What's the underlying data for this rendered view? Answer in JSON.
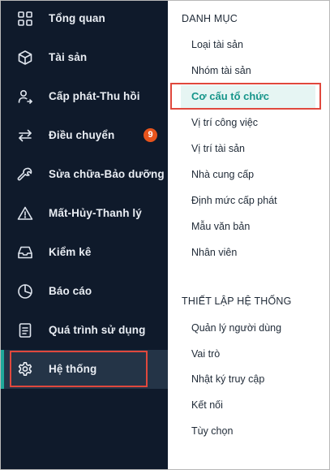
{
  "sidebar": {
    "items": [
      {
        "label": "Tổng quan",
        "icon": "dashboard-grid-icon"
      },
      {
        "label": "Tài sản",
        "icon": "box-icon"
      },
      {
        "label": "Cấp phát-Thu hồi",
        "icon": "user-transfer-icon"
      },
      {
        "label": "Điều chuyển",
        "icon": "swap-arrows-icon",
        "badge": "9"
      },
      {
        "label": "Sửa chữa-Bảo dưỡng",
        "icon": "wrench-icon"
      },
      {
        "label": "Mất-Hủy-Thanh lý",
        "icon": "warning-triangle-icon"
      },
      {
        "label": "Kiểm kê",
        "icon": "inbox-tray-icon"
      },
      {
        "label": "Báo cáo",
        "icon": "pie-chart-icon"
      },
      {
        "label": "Quá trình sử dụng",
        "icon": "document-list-icon"
      },
      {
        "label": "Hệ thống",
        "icon": "gear-icon",
        "active": true
      }
    ]
  },
  "submenu": {
    "sections": [
      {
        "title": "DANH MỤC",
        "items": [
          "Loại tài sản",
          "Nhóm tài sản",
          "Cơ cấu tổ chức",
          "Vị trí công việc",
          "Vị trí tài sản",
          "Nhà cung cấp",
          "Định mức cấp phát",
          "Mẫu văn bản",
          "Nhân viên"
        ],
        "active_item": "Cơ cấu tổ chức"
      },
      {
        "title": "THIẾT LẬP HỆ THỐNG",
        "items": [
          "Quản lý người dùng",
          "Vai trò",
          "Nhật ký truy cập",
          "Kết nối",
          "Tùy chọn"
        ]
      }
    ]
  },
  "colors": {
    "sidebar_bg": "#0f1a2b",
    "active_bg": "#243447",
    "accent": "#1fa89a",
    "badge": "#e8541c",
    "highlight_border": "#e0483d",
    "active_text": "#16958a"
  }
}
